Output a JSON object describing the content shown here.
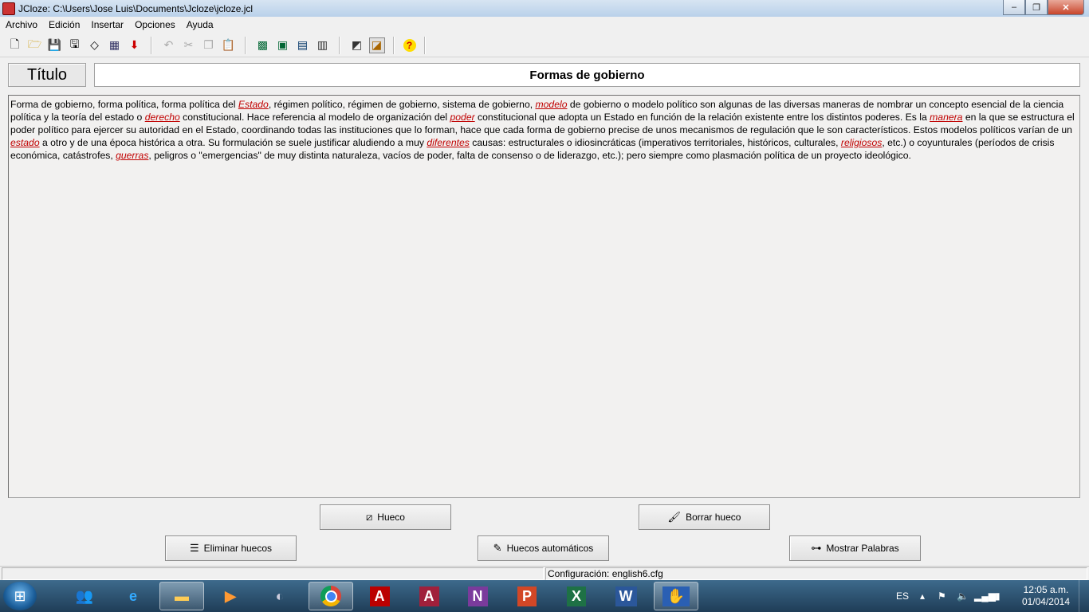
{
  "window": {
    "title": "JCloze: C:\\Users\\Jose Luis\\Documents\\Jcloze\\jcloze.jcl",
    "controls": {
      "minimize": "–",
      "maximize": "❐",
      "close": "✕"
    }
  },
  "menu": {
    "items": [
      "Archivo",
      "Edición",
      "Insertar",
      "Opciones",
      "Ayuda"
    ]
  },
  "toolbar": {
    "icons": [
      "new-file-icon",
      "open-folder-icon",
      "save-icon",
      "save-as-icon",
      "eraser-icon",
      "web-page-icon",
      "export-down-icon",
      "undo-icon",
      "cut-icon",
      "copy-icon",
      "paste-icon",
      "webpage-export-icon",
      "export-package-icon",
      "export-scorm-icon",
      "export-hotpot-icon",
      "masher-icon",
      "config-icon",
      "help-icon"
    ]
  },
  "title_row": {
    "label": "Título",
    "value": "Formas de gobierno"
  },
  "body_text": {
    "segments": [
      {
        "t": "Forma de gobierno, forma política, forma política del ",
        "gap": false
      },
      {
        "t": "Estado",
        "gap": true
      },
      {
        "t": ", régimen político, régimen de gobierno, sistema de gobierno, ",
        "gap": false
      },
      {
        "t": "modelo",
        "gap": true
      },
      {
        "t": " de gobierno o modelo político son algunas de las diversas maneras de nombrar un concepto esencial de la ciencia política y la teoría del estado o ",
        "gap": false
      },
      {
        "t": "derecho",
        "gap": true
      },
      {
        "t": " constitucional. Hace referencia al modelo de organización del ",
        "gap": false
      },
      {
        "t": "poder",
        "gap": true
      },
      {
        "t": " constitucional que adopta un Estado en función de la relación existente entre los distintos poderes. Es la ",
        "gap": false
      },
      {
        "t": "manera",
        "gap": true
      },
      {
        "t": " en la que se estructura el poder político para ejercer su autoridad en el Estado, coordinando todas las instituciones que lo forman, hace que cada forma de gobierno precise de unos mecanismos de regulación que le son característicos. Estos modelos políticos varían de un ",
        "gap": false
      },
      {
        "t": "estado",
        "gap": true
      },
      {
        "t": " a otro y de una época histórica a otra. Su formulación se suele justificar aludiendo a muy ",
        "gap": false
      },
      {
        "t": "diferentes",
        "gap": true
      },
      {
        "t": " causas: estructurales o idiosincráticas (imperativos territoriales, históricos, culturales, ",
        "gap": false
      },
      {
        "t": "religiosos",
        "gap": true
      },
      {
        "t": ", etc.) o coyunturales (períodos de crisis económica, catástrofes, ",
        "gap": false
      },
      {
        "t": "guerras",
        "gap": true
      },
      {
        "t": ", peligros o \"emergencias\" de muy distinta naturaleza, vacíos de poder, falta de consenso o de liderazgo, etc.); pero siempre como plasmación política de un proyecto ideológico.",
        "gap": false
      }
    ]
  },
  "buttons": {
    "hueco": "Hueco",
    "borrar_hueco": "Borrar hueco",
    "eliminar_huecos": "Eliminar huecos",
    "huecos_automaticos": "Huecos automáticos",
    "mostrar_palabras": "Mostrar Palabras"
  },
  "status": {
    "config": "Configuración: english6.cfg"
  },
  "taskbar": {
    "apps": [
      "people-icon",
      "internet-explorer-icon",
      "file-explorer-icon",
      "media-player-icon",
      "remote-icon",
      "chrome-icon",
      "acrobat-icon",
      "access-icon",
      "onenote-icon",
      "powerpoint-icon",
      "excel-icon",
      "word-icon",
      "jcloze-icon"
    ],
    "language": "ES",
    "time": "12:05 a.m.",
    "date": "01/04/2014"
  },
  "colors": {
    "gap_text": "#c00000",
    "taskbar": "#2b4f6e"
  }
}
